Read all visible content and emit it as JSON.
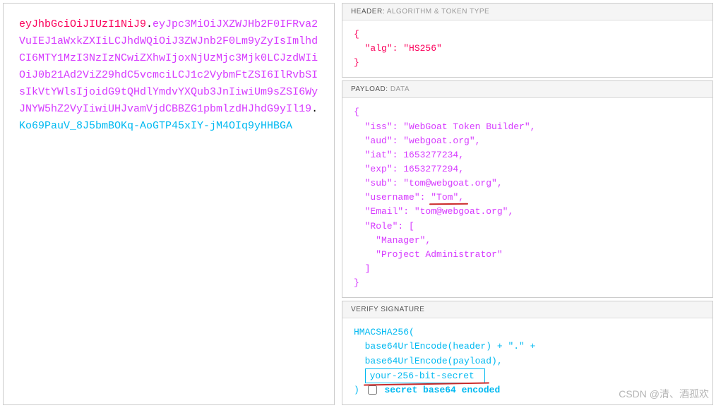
{
  "jwt": {
    "header_token": "eyJhbGciOiJIUzI1NiJ9",
    "payload_token": "eyJpc3MiOiJXZWJHb2F0IFRva2VuIEJ1aWxkZXIiLCJhdWQiOiJ3ZWJnb2F0Lm9yZyIsImlhdCI6MTY1MzI3NzIzNCwiZXhwIjoxNjUzMjc3Mjk0LCJzdWIiOiJ0b21Ad2ViZ29hdC5vcmciLCJ1c2VybmFtZSI6IlRvbSIsIkVtYWlsIjoidG9tQHdlYmdvYXQub3JnIiwiUm9sZSI6WyJNYW5hZ2VyIiwiUHJvamVjdCBBZG1pbmlzdHJhdG9yIl19",
    "signature_token": "Ko69PauV_8J5bmBOKq-AoGTP45xIY-jM4OIq9yHHBGA"
  },
  "headers": {
    "header_title": "HEADER:",
    "header_sub": "ALGORITHM & TOKEN TYPE",
    "payload_title": "PAYLOAD:",
    "payload_sub": "DATA",
    "signature_title": "VERIFY SIGNATURE"
  },
  "decoded_header": {
    "alg": "HS256"
  },
  "decoded_payload": {
    "iss": "WebGoat Token Builder",
    "aud": "webgoat.org",
    "iat": 1653277234,
    "exp": 1653277294,
    "sub": "tom@webgoat.org",
    "username": "Tom",
    "Email": "tom@webgoat.org",
    "Role": [
      "Manager",
      "Project Administrator"
    ]
  },
  "signature": {
    "algo": "HMACSHA256(",
    "line1": "base64UrlEncode(header) + \".\" +",
    "line2": "base64UrlEncode(payload),",
    "secret_placeholder": "your-256-bit-secret",
    "close": ")",
    "checkbox_label": "secret base64 encoded"
  },
  "watermark": "CSDN @清、酒孤欢"
}
